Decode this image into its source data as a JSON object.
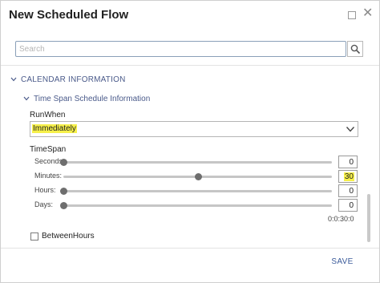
{
  "dialog": {
    "title": "New Scheduled Flow"
  },
  "search": {
    "placeholder": "Search",
    "value": ""
  },
  "section": {
    "label": "CALENDAR INFORMATION"
  },
  "subsection": {
    "label": "Time Span Schedule Information"
  },
  "runwhen": {
    "label": "RunWhen",
    "selected": "Immediately"
  },
  "timespan": {
    "label": "TimeSpan",
    "sliders": [
      {
        "label": "Seconds:",
        "value": "0",
        "level": 0.0,
        "highlighted": false
      },
      {
        "label": "Minutes:",
        "value": "30",
        "level": 0.5,
        "highlighted": true
      },
      {
        "label": "Hours:",
        "value": "0",
        "level": 0.0,
        "highlighted": false
      },
      {
        "label": "Days:",
        "value": "0",
        "level": 0.0,
        "highlighted": false
      }
    ],
    "summary": "0:0:30:0"
  },
  "between_hours": {
    "label": "BetweenHours",
    "checked": false
  },
  "footer": {
    "save_label": "SAVE"
  },
  "colors": {
    "accent": "#3a5a9a",
    "highlight": "#f6f04a"
  }
}
